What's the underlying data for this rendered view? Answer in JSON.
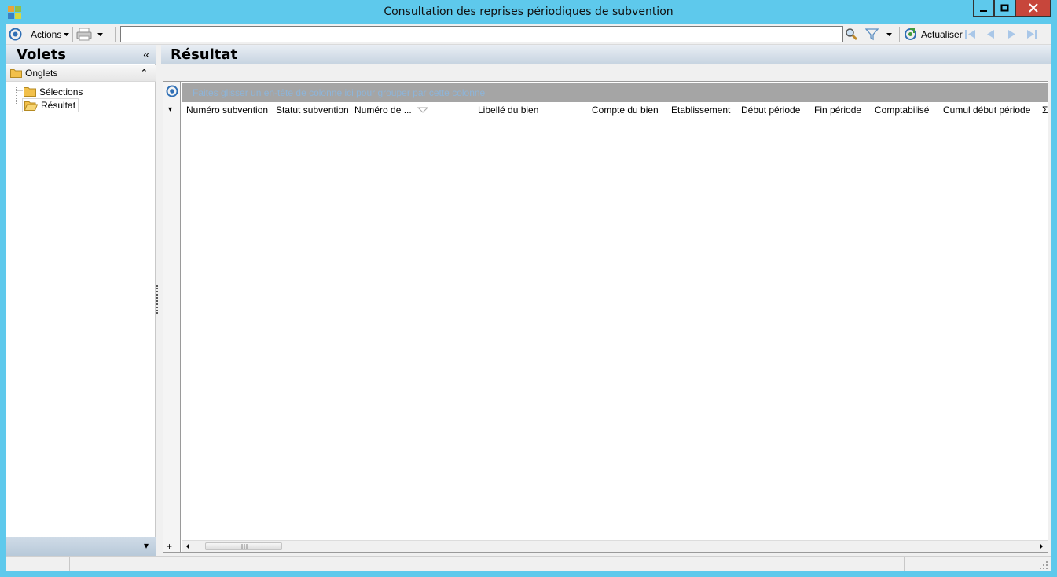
{
  "window": {
    "title": "Consultation des reprises périodiques de subvention",
    "colors": {
      "frame": "#5ec9ec",
      "close": "#c7463b",
      "accent": "#2f6fb5"
    }
  },
  "toolbar": {
    "actions_label": "Actions",
    "search_value": "",
    "refresh_label": "Actualiser",
    "icons": [
      "target-icon",
      "printer-icon",
      "search-icon",
      "filter-icon",
      "refresh-icon",
      "first-icon",
      "previous-icon",
      "next-icon",
      "last-icon"
    ]
  },
  "left_pane": {
    "title": "Volets",
    "collapse_glyph": "«",
    "group_label": "Onglets",
    "group_toggle_glyph": "⌃",
    "items": [
      {
        "label": "Sélections"
      },
      {
        "label": "Résultat"
      }
    ],
    "footer_glyph": "▾"
  },
  "result": {
    "title": "Résultat",
    "group_hint": "Faites glisser un en-tête de colonne ici pour grouper par cette colonne",
    "columns": [
      "Numéro subvention",
      "Statut subvention",
      "Numéro de ...",
      "Libellé du bien",
      "Compte du bien",
      "Etablissement",
      "Début période",
      "Fin période",
      "Comptabilisé",
      "Cumul début période"
    ],
    "sum_glyph": "Σ",
    "row_menu_glyph": "▾",
    "add_glyph": "+"
  }
}
